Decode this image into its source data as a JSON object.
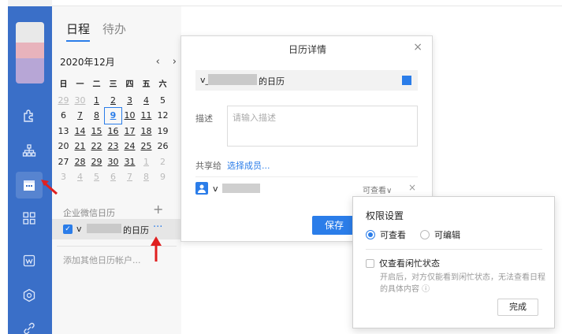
{
  "tabs": [
    {
      "label": "日程",
      "active": true
    },
    {
      "label": "待办",
      "active": false
    }
  ],
  "calendar": {
    "month_label": "2020年12月",
    "prev": "‹",
    "next": "›",
    "weekdays": [
      "日",
      "一",
      "二",
      "三",
      "四",
      "五",
      "六"
    ],
    "weeks": [
      [
        "29",
        "30",
        "1",
        "2",
        "3",
        "4",
        "5"
      ],
      [
        "6",
        "7",
        "8",
        "9",
        "10",
        "11",
        "12"
      ],
      [
        "13",
        "14",
        "15",
        "16",
        "17",
        "18",
        "19"
      ],
      [
        "20",
        "21",
        "22",
        "23",
        "24",
        "25",
        "26"
      ],
      [
        "27",
        "28",
        "29",
        "30",
        "31",
        "1",
        "2"
      ],
      [
        "3",
        "4",
        "5",
        "6",
        "7",
        "8",
        "9"
      ]
    ],
    "today": "9"
  },
  "calendars_section": {
    "title": "企业微信日历",
    "add": "+",
    "item_prefix": "v",
    "item_suffix": "的日历",
    "more": "···",
    "add_account": "添加其他日历帐户..."
  },
  "dialog": {
    "title": "日历详情",
    "close": "×",
    "name_prefix": "v_",
    "name_suffix": "的日历",
    "desc_label": "描述",
    "desc_placeholder": "请输入描述",
    "share_label": "共享给",
    "share_link": "选择成员...",
    "member_prefix": "v",
    "member_permission": "可查看∨",
    "member_remove": "×",
    "save": "保存",
    "color": "#2b7de9"
  },
  "popup": {
    "title": "权限设置",
    "option_view": "可查看",
    "option_edit": "可编辑",
    "busy_only": "仅查看闲忙状态",
    "busy_desc": "开启后，对方仅能看到闲忙状态，无法查看日程的具体内容 ⓘ",
    "done": "完成"
  }
}
